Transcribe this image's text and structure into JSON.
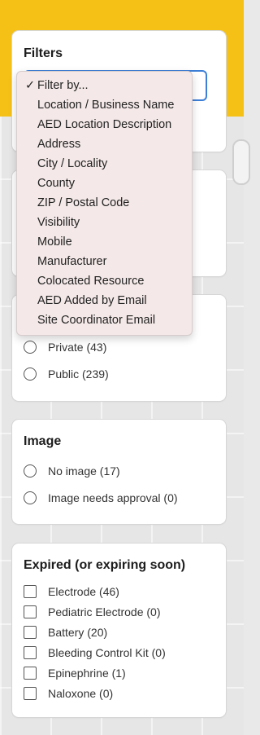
{
  "filters_card": {
    "title": "Filters",
    "dropdown_options": [
      {
        "label": "Filter by...",
        "selected": true
      },
      {
        "label": "Location / Business Name"
      },
      {
        "label": "AED Location Description"
      },
      {
        "label": "Address"
      },
      {
        "label": "City / Locality"
      },
      {
        "label": "County"
      },
      {
        "label": "ZIP / Postal Code"
      },
      {
        "label": "Visibility"
      },
      {
        "label": "Mobile"
      },
      {
        "label": "Manufacturer"
      },
      {
        "label": "Colocated Resource"
      },
      {
        "label": "AED Added by Email"
      },
      {
        "label": "Site Coordinator Email"
      }
    ],
    "check_mark": "✓"
  },
  "visibility_card": {
    "options": [
      "Private (43)",
      "Public (239)"
    ]
  },
  "image_card": {
    "title": "Image",
    "options": [
      "No image (17)",
      "Image needs approval (0)"
    ]
  },
  "expired_card": {
    "title": "Expired (or expiring soon)",
    "options": [
      "Electrode (46)",
      "Pediatric Electrode (0)",
      "Battery (20)",
      "Bleeding Control Kit (0)",
      "Epinephrine (1)",
      "Naloxone (0)"
    ]
  },
  "colors": {
    "header_yellow": "#f5c117",
    "focus_blue": "#3d7fd6",
    "dropdown_bg": "#f4e8e8"
  }
}
